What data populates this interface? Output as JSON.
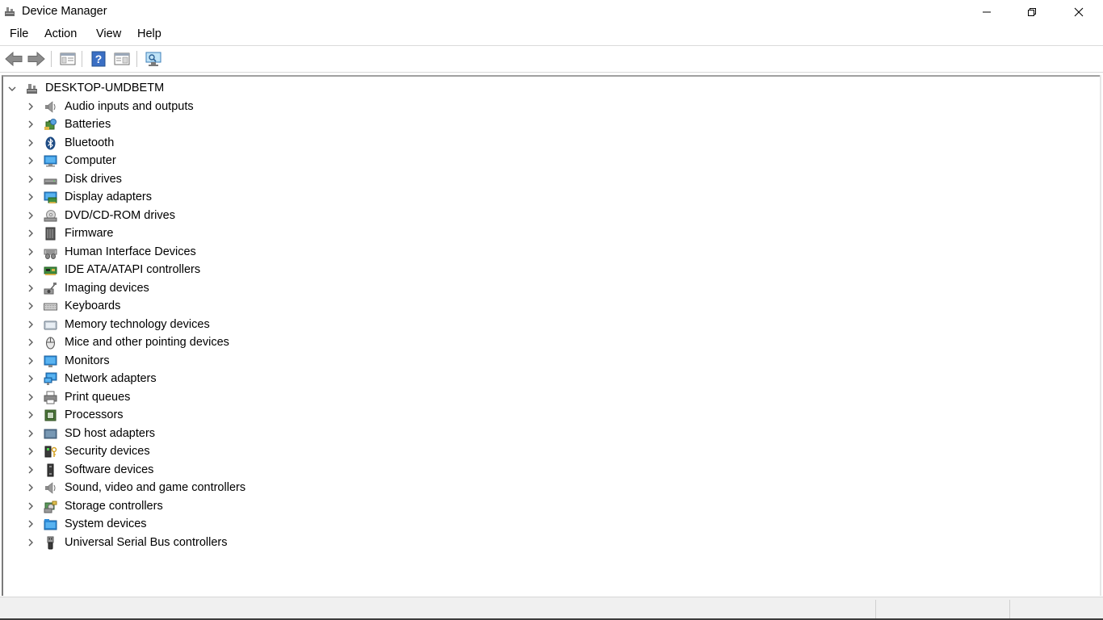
{
  "window": {
    "title": "Device Manager",
    "controls": [
      "minimize",
      "restore",
      "close"
    ]
  },
  "menu": [
    {
      "label": "File"
    },
    {
      "label": "Action"
    },
    {
      "label": "View"
    },
    {
      "label": "Help"
    }
  ],
  "toolbar": {
    "buttons": [
      "back-arrow-icon",
      "forward-arrow-icon",
      "show-hide-console-tree-icon",
      "help-icon",
      "properties-icon",
      "scan-hardware-changes-icon"
    ]
  },
  "tree": {
    "root": {
      "label": "DESKTOP-UMDBETM",
      "expanded": true
    },
    "categories": [
      {
        "label": "Audio inputs and outputs",
        "icon": "speaker-icon"
      },
      {
        "label": "Batteries",
        "icon": "battery-icon"
      },
      {
        "label": "Bluetooth",
        "icon": "bluetooth-icon"
      },
      {
        "label": "Computer",
        "icon": "computer-icon"
      },
      {
        "label": "Disk drives",
        "icon": "disk-drive-icon"
      },
      {
        "label": "Display adapters",
        "icon": "display-adapter-icon"
      },
      {
        "label": "DVD/CD-ROM drives",
        "icon": "dvd-drive-icon"
      },
      {
        "label": "Firmware",
        "icon": "firmware-icon"
      },
      {
        "label": "Human Interface Devices",
        "icon": "hid-icon"
      },
      {
        "label": "IDE ATA/ATAPI controllers",
        "icon": "ide-controller-icon"
      },
      {
        "label": "Imaging devices",
        "icon": "camera-icon"
      },
      {
        "label": "Keyboards",
        "icon": "keyboard-icon"
      },
      {
        "label": "Memory technology devices",
        "icon": "memory-icon"
      },
      {
        "label": "Mice and other pointing devices",
        "icon": "mouse-icon"
      },
      {
        "label": "Monitors",
        "icon": "monitor-icon"
      },
      {
        "label": "Network adapters",
        "icon": "network-adapter-icon"
      },
      {
        "label": "Print queues",
        "icon": "printer-icon"
      },
      {
        "label": "Processors",
        "icon": "processor-icon"
      },
      {
        "label": "SD host adapters",
        "icon": "sd-card-icon"
      },
      {
        "label": "Security devices",
        "icon": "security-key-icon"
      },
      {
        "label": "Software devices",
        "icon": "software-device-icon"
      },
      {
        "label": "Sound, video and game controllers",
        "icon": "speaker-icon"
      },
      {
        "label": "Storage controllers",
        "icon": "storage-controller-icon"
      },
      {
        "label": "System devices",
        "icon": "system-folder-icon"
      },
      {
        "label": "Universal Serial Bus controllers",
        "icon": "usb-icon"
      }
    ]
  },
  "colors": {
    "chevron": "#5a5a5a",
    "status_bar_bg": "#f0f0f0",
    "accent_blue": "#1e72c8"
  }
}
